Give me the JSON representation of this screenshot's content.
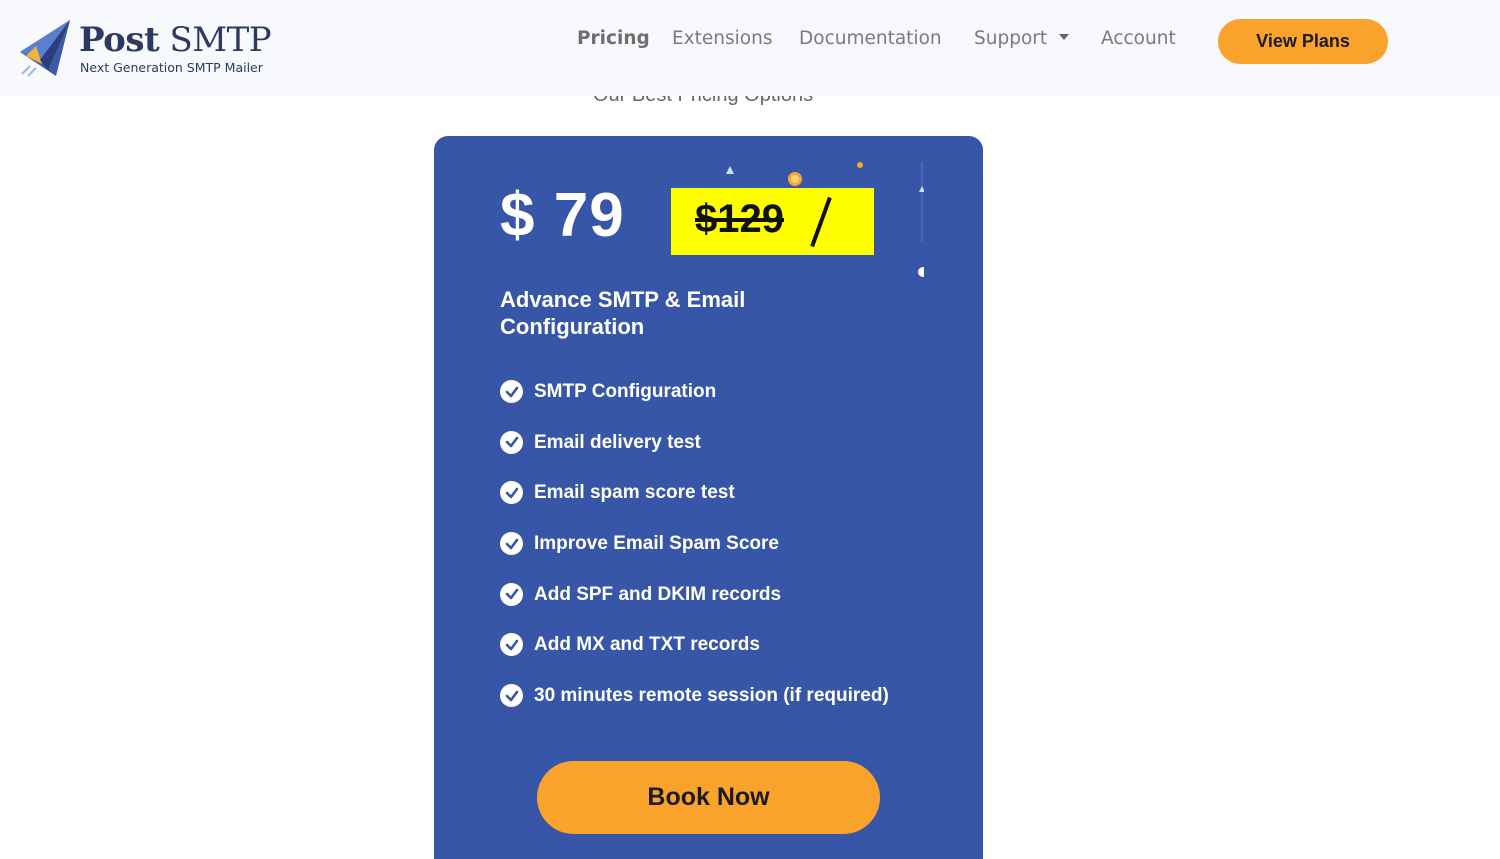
{
  "brand": {
    "name_bold": "Post",
    "name_rest": "SMTP",
    "tagline": "Next Generation SMTP Mailer",
    "logo_icon": "paper-plane-icon"
  },
  "nav": {
    "items": [
      {
        "label": "Pricing",
        "active": true
      },
      {
        "label": "Extensions",
        "active": false
      },
      {
        "label": "Documentation",
        "active": false
      },
      {
        "label": "Support",
        "active": false,
        "has_dropdown": true
      },
      {
        "label": "Account",
        "active": false
      }
    ],
    "cta_label": "View Plans"
  },
  "section": {
    "subtitle": "Our Best Pricing Options"
  },
  "plan": {
    "price": "$ 79",
    "old_price": "$129",
    "title": "Advance SMTP & Email Configuration",
    "features": [
      "SMTP Configuration",
      "Email delivery test",
      "Email spam score test",
      "Improve Email Spam Score",
      "Add SPF and DKIM records",
      "Add MX and TXT records",
      "30 minutes remote session (if required)"
    ],
    "feature_icon": "check-circle-icon",
    "cta_label": "Book Now"
  },
  "colors": {
    "card_bg": "#3856a8",
    "accent": "#f9a22c",
    "highlight": "#ffff00",
    "header_bg": "#f7f9fc"
  }
}
